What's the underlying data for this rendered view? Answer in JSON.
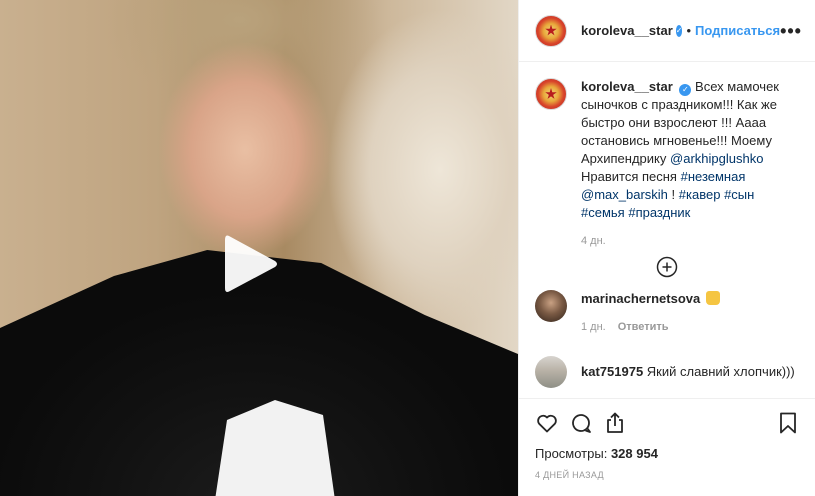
{
  "post": {
    "username": "koroleva__star",
    "verified_mark": "✓",
    "separator": "•",
    "follow_label": "Подписаться",
    "more_label": "•••"
  },
  "caption": {
    "username": "koroleva__star",
    "text_1": "Всех мамочек сыночков с праздником!!! Как же быстро они взрослеют !!! Аааа остановись мгновенье!!! Моему Архипендрику",
    "mention_1": "@arkhipglushko",
    "text_2": "Нравится песня",
    "hashtag_1": "#неземная",
    "mention_2": "@max_barskih",
    "text_3": "!",
    "hashtag_2": "#кавер",
    "hashtag_3": "#сын",
    "hashtag_4": "#семья",
    "hashtag_5": "#праздник",
    "time": "4 дн."
  },
  "comments": [
    {
      "username": "marinachernetsova",
      "text": "",
      "time": "1 дн.",
      "reply_label": "Ответить"
    },
    {
      "username": "kat751975",
      "text": "Який славний хлопчик)))"
    }
  ],
  "icons": {
    "play": "play-icon",
    "load_more": "plus-circle-icon",
    "like": "heart-icon",
    "comment": "comment-icon",
    "share": "share-icon",
    "save": "bookmark-icon"
  },
  "stats": {
    "views_label": "Просмотры:",
    "views_value": "328 954",
    "date": "4 дней назад"
  },
  "colors": {
    "accent": "#3897f0",
    "link": "#003569",
    "muted": "#999999"
  }
}
